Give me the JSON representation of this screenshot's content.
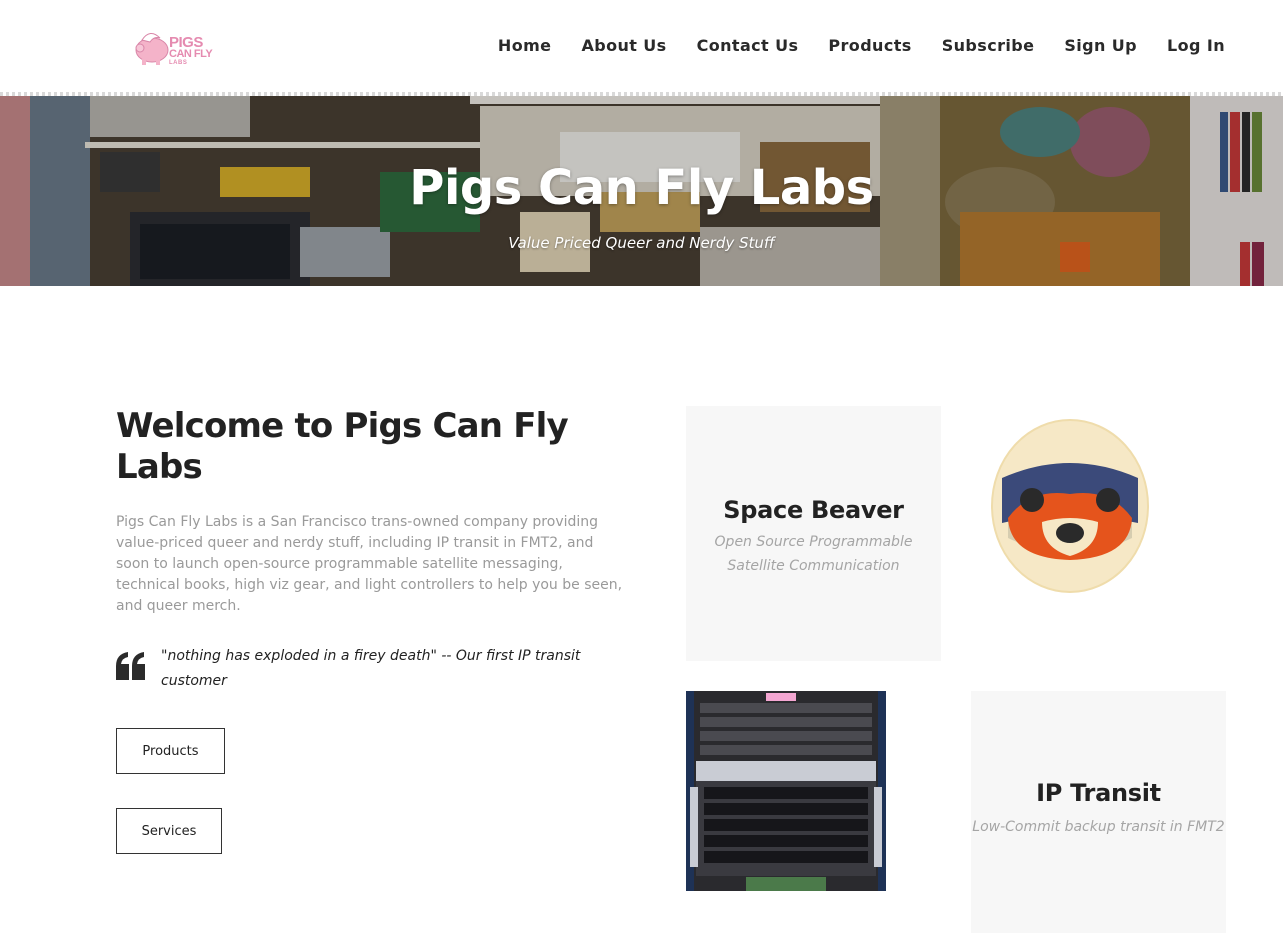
{
  "header": {
    "logo": {
      "line1": "PIGS",
      "line2": "CAN FLY",
      "line3": "LABS"
    },
    "nav": [
      "Home",
      "About Us",
      "Contact Us",
      "Products",
      "Subscribe",
      "Sign Up",
      "Log In"
    ]
  },
  "hero": {
    "title": "Pigs Can Fly Labs",
    "subtitle": "Value Priced Queer and Nerdy Stuff"
  },
  "welcome": {
    "title": "Welcome to Pigs Can Fly Labs",
    "body": "Pigs Can Fly Labs is a San Francisco trans-owned company providing value-priced queer and nerdy stuff, including IP transit in FMT2, and soon to launch open-source programmable satellite messaging, technical books, high viz gear, and light controllers to help you be seen, and queer merch.",
    "quote": "\"nothing has exploded in a firey death\" -- Our first IP transit customer",
    "buttons": {
      "products": "Products",
      "services": "Services"
    }
  },
  "cards": {
    "space_beaver": {
      "title": "Space Beaver",
      "subtitle": "Open Source Programmable Satellite Communication"
    },
    "ip_transit": {
      "title": "IP Transit",
      "subtitle": "Low-Commit backup transit in FMT2"
    }
  },
  "colors": {
    "logo_pink": "#e58bb0",
    "card_bg": "#f7f7f7",
    "body_text_gray": "#9a9a9a",
    "beaver_orange": "#e5541c"
  }
}
